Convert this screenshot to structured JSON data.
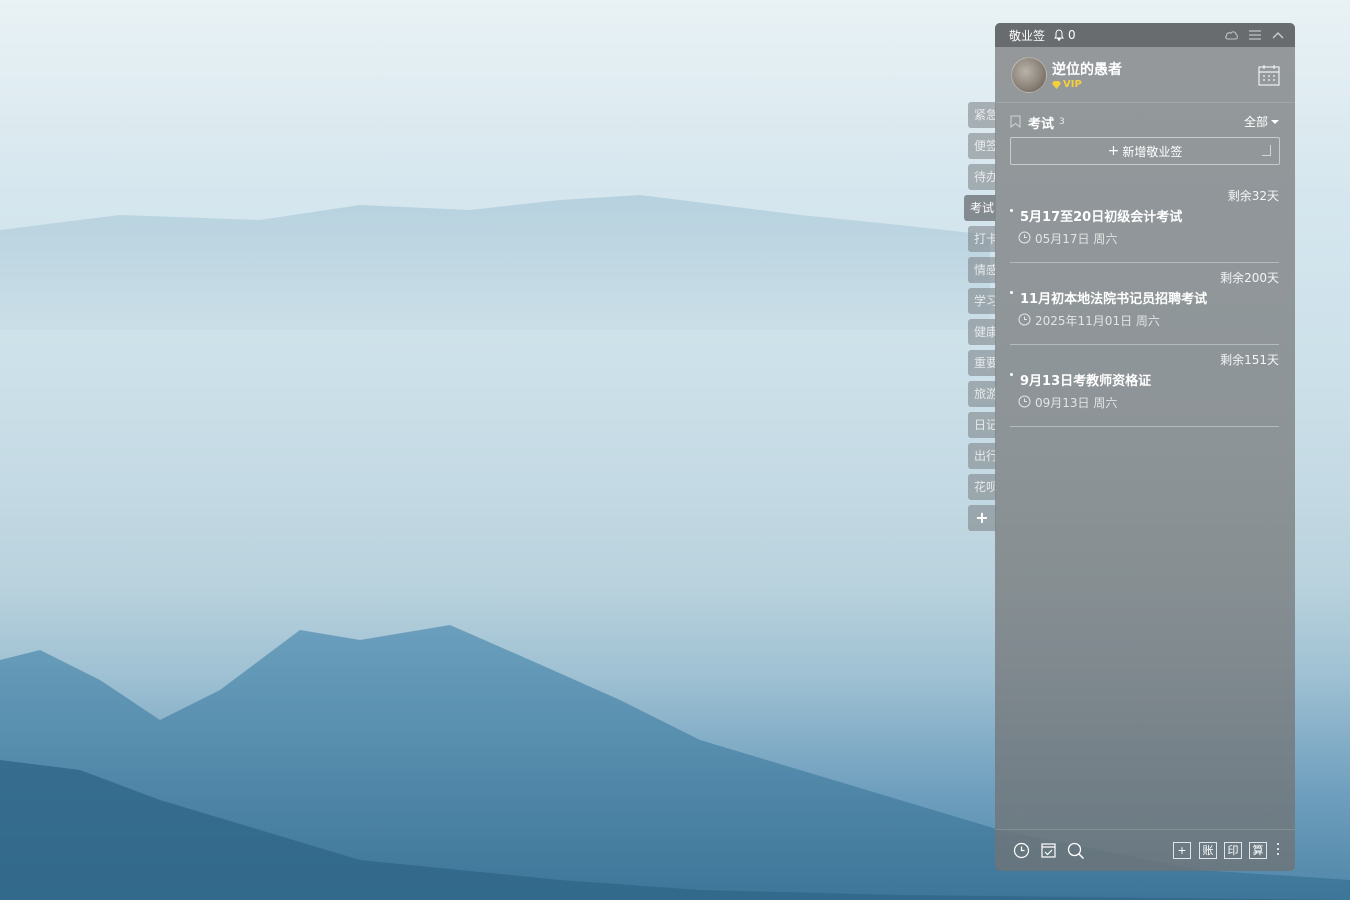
{
  "app": {
    "name": "敬业签",
    "notification_count": "0"
  },
  "user": {
    "name": "逆位的愚者",
    "badge": "VIP"
  },
  "side_tabs": [
    "紧急",
    "便签",
    "待办",
    "考试",
    "打卡",
    "情感",
    "学习",
    "健康",
    "重要",
    "旅游",
    "日记",
    "出行",
    "花呗"
  ],
  "side_tab_add": "+",
  "category": {
    "name": "考试",
    "count": "3",
    "filter": "全部"
  },
  "add_button": {
    "plus": "+",
    "label": "新增敬业签"
  },
  "notes": [
    {
      "remaining": "剩余32天",
      "title": "5月17至20日初级会计考试",
      "date": "05月17日 周六"
    },
    {
      "remaining": "剩余200天",
      "title": "11月初本地法院书记员招聘考试",
      "date": "2025年11月01日 周六"
    },
    {
      "remaining": "剩余151天",
      "title": "9月13日考教师资格证",
      "date": "09月13日 周六"
    }
  ],
  "bottom_bar": {
    "box_buttons": [
      "+",
      "账",
      "印",
      "算"
    ]
  },
  "icons": {
    "title_bar": [
      "bell-icon",
      "cloud-sync-icon",
      "menu-icon",
      "collapse-icon"
    ],
    "bottom_left": [
      "clock-icon",
      "checklist-icon",
      "search-icon"
    ],
    "header": [
      "calendar-icon",
      "bookmark-icon"
    ]
  },
  "colors": {
    "vip": "#f4d03f",
    "panel_bg": "#85888a"
  }
}
